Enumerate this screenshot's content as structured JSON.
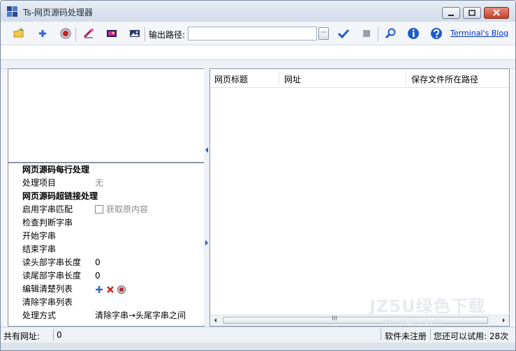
{
  "window": {
    "title": "Ts-网页源码处理器"
  },
  "toolbar": {
    "output_path_label": "输出路径:",
    "output_path_value": "",
    "browse_label": "···",
    "blog_link": "Terminal's Blog"
  },
  "left_properties": {
    "rows": [
      {
        "type": "category",
        "label": "网页源码每行处理",
        "value": ""
      },
      {
        "type": "item",
        "label": "处理项目",
        "value": "无"
      },
      {
        "type": "category",
        "label": "网页源码超链接处理",
        "value": ""
      },
      {
        "type": "item",
        "label": "启用字串匹配",
        "value": "获取原内容"
      },
      {
        "type": "item",
        "label": "检查判断字串",
        "value": ""
      },
      {
        "type": "item",
        "label": "开始字串",
        "value": ""
      },
      {
        "type": "item",
        "label": "结束字串",
        "value": ""
      },
      {
        "type": "item",
        "label": "读头部字串长度",
        "value": "0"
      },
      {
        "type": "item",
        "label": "读尾部字串长度",
        "value": "0"
      },
      {
        "type": "item",
        "label": "编辑清楚列表",
        "value": ""
      },
      {
        "type": "item",
        "label": "清除字串列表",
        "value": ""
      },
      {
        "type": "item",
        "label": "处理方式",
        "value": "清除字串→头尾字串之间"
      }
    ]
  },
  "table": {
    "columns": [
      "网页标题",
      "网址",
      "保存文件所在路径"
    ],
    "scroll_grip": "III"
  },
  "status": {
    "count_label": "共有网址:",
    "count_value": "0",
    "register": "软件未注册",
    "trial": "您还可以试用: 28次"
  },
  "watermark": {
    "main": "JZ5U绿色下载",
    "sub": "www.jz5u.com"
  },
  "colors": {
    "accent_blue": "#1e5cc8",
    "link": "#0033cc",
    "close_red": "#c4412a"
  }
}
